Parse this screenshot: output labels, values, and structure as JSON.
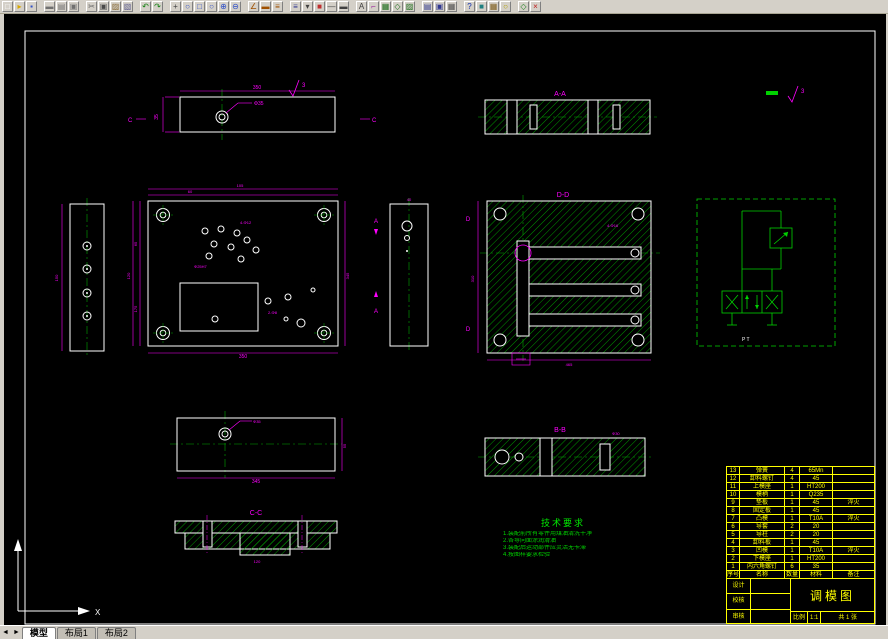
{
  "colors": {
    "chrome": "#d4d0c8",
    "canvas_bg": "#000000",
    "outline": "#ffffff",
    "dimension": "#ff00ff",
    "hatch": "#00a800",
    "annotation_green": "#00d200",
    "table": "#ffff00"
  },
  "toolbar": {
    "icons": [
      {
        "name": "new-icon",
        "glyph": "□",
        "color": "#ffffff"
      },
      {
        "name": "open-icon",
        "glyph": "▸",
        "color": "#d8a800"
      },
      {
        "name": "save-icon",
        "glyph": "▪",
        "color": "#3050c8"
      },
      {
        "name": "plot-icon",
        "glyph": "▬",
        "color": "#707070",
        "sep": true
      },
      {
        "name": "print-preview-icon",
        "glyph": "▤",
        "color": "#707070"
      },
      {
        "name": "publish-icon",
        "glyph": "▣",
        "color": "#707070"
      },
      {
        "name": "cut-icon",
        "glyph": "✂",
        "color": "#606060",
        "sep": true
      },
      {
        "name": "copy-icon",
        "glyph": "▣",
        "color": "#4a4a4a"
      },
      {
        "name": "paste-icon",
        "glyph": "▨",
        "color": "#8a6d3b"
      },
      {
        "name": "match-properties-icon",
        "glyph": "▧",
        "color": "#606090"
      },
      {
        "name": "undo-icon",
        "glyph": "↶",
        "color": "#108010",
        "sep": true
      },
      {
        "name": "redo-icon",
        "glyph": "↷",
        "color": "#108010"
      },
      {
        "name": "pan-icon",
        "glyph": "+",
        "color": "#404040",
        "sep": true
      },
      {
        "name": "zoom-realtime-icon",
        "glyph": "○",
        "color": "#3050c8"
      },
      {
        "name": "zoom-window-icon",
        "glyph": "□",
        "color": "#3050c8"
      },
      {
        "name": "zoom-previous-icon",
        "glyph": "○",
        "color": "#3050c8"
      },
      {
        "name": "zoom-in-icon",
        "glyph": "⊕",
        "color": "#3050c8"
      },
      {
        "name": "zoom-out-icon",
        "glyph": "⊖",
        "color": "#3050c8"
      },
      {
        "name": "distance-icon",
        "glyph": "∠",
        "color": "#a05000",
        "sep": true
      },
      {
        "name": "area-icon",
        "glyph": "▬",
        "color": "#a05000"
      },
      {
        "name": "list-icon",
        "glyph": "≡",
        "color": "#a05000"
      },
      {
        "name": "layers-icon",
        "glyph": "≡",
        "color": "#303890",
        "sep": true
      },
      {
        "name": "layer-control-icon",
        "glyph": "▾",
        "color": "#404040"
      },
      {
        "name": "color-control-icon",
        "glyph": "■",
        "color": "#c03030"
      },
      {
        "name": "linetype-icon",
        "glyph": "—",
        "color": "#404040"
      },
      {
        "name": "lineweight-icon",
        "glyph": "▬",
        "color": "#404040"
      },
      {
        "name": "text-style-icon",
        "glyph": "A",
        "color": "#404040",
        "sep": true
      },
      {
        "name": "dim-style-icon",
        "glyph": "⌐",
        "color": "#a030a0"
      },
      {
        "name": "table-icon",
        "glyph": "▦",
        "color": "#207020"
      },
      {
        "name": "block-icon",
        "glyph": "◇",
        "color": "#207020"
      },
      {
        "name": "hatch-tool-icon",
        "glyph": "▨",
        "color": "#207020"
      },
      {
        "name": "properties-icon",
        "glyph": "▤",
        "color": "#303890",
        "sep": true
      },
      {
        "name": "designcenter-icon",
        "glyph": "▣",
        "color": "#303890"
      },
      {
        "name": "calculator-icon",
        "glyph": "▦",
        "color": "#505050"
      },
      {
        "name": "help-icon",
        "glyph": "?",
        "color": "#1030b0",
        "sep": true
      },
      {
        "name": "render-icon",
        "glyph": "■",
        "color": "#208080"
      },
      {
        "name": "materials-icon",
        "glyph": "▦",
        "color": "#806020"
      },
      {
        "name": "lights-icon",
        "glyph": "○",
        "color": "#b0a000"
      },
      {
        "name": "osnap-icon",
        "glyph": "◇",
        "color": "#208020",
        "sep": true
      },
      {
        "name": "exit-icon",
        "glyph": "×",
        "color": "#c02020"
      }
    ]
  },
  "drawing": {
    "labels": {
      "section_aa": "A-A",
      "section_bb": "B-B",
      "section_cc": "C-C",
      "section_dd": "D-D",
      "ports": "P T",
      "ucs_x": "X",
      "roughness_grade": "3"
    },
    "dims": {
      "plate_width": "350",
      "plate_thick": "35",
      "hole_dia": "Φ35",
      "side_plate_len": "150",
      "v1": "65",
      "v2": "120",
      "v3": "175",
      "plate_height": "345",
      "holes_note": "4-Φ12",
      "bore_note": "Φ25H7",
      "pin_note": "2-Φ8",
      "hatch_height": "310",
      "hatch_width": "465",
      "plate2_w": "40",
      "bottom_thick": "55",
      "cc_dim": "120",
      "bb_dia": "Φ30",
      "t1": "60",
      "t2": "105",
      "holes_note2": "4-Φ16",
      "sec_c": "C",
      "sec_a": "A",
      "sec_d": "D"
    },
    "tech_req": {
      "title": "技术要求",
      "lines": [
        "1.装配前所有零件用煤油清洗干净",
        "2.各导向面涂润滑油",
        "3.装配后运动部件应灵活无卡滞",
        "4.按图样要求检验"
      ]
    }
  },
  "title_block": {
    "parts_header": {
      "no": "序号",
      "name": "名称",
      "qty": "数量",
      "mat": "材料",
      "rem": "备注"
    },
    "parts": [
      {
        "no": "13",
        "name": "弹簧",
        "qty": "4",
        "mat": "65Mn",
        "rem": ""
      },
      {
        "no": "12",
        "name": "卸料螺钉",
        "qty": "4",
        "mat": "45",
        "rem": ""
      },
      {
        "no": "11",
        "name": "上模座",
        "qty": "1",
        "mat": "HT200",
        "rem": ""
      },
      {
        "no": "10",
        "name": "模柄",
        "qty": "1",
        "mat": "Q235",
        "rem": ""
      },
      {
        "no": "9",
        "name": "垫板",
        "qty": "1",
        "mat": "45",
        "rem": "淬火"
      },
      {
        "no": "8",
        "name": "固定板",
        "qty": "1",
        "mat": "45",
        "rem": ""
      },
      {
        "no": "7",
        "name": "凸模",
        "qty": "1",
        "mat": "T10A",
        "rem": "淬火"
      },
      {
        "no": "6",
        "name": "导套",
        "qty": "2",
        "mat": "20",
        "rem": ""
      },
      {
        "no": "5",
        "name": "导柱",
        "qty": "2",
        "mat": "20",
        "rem": ""
      },
      {
        "no": "4",
        "name": "卸料板",
        "qty": "1",
        "mat": "45",
        "rem": ""
      },
      {
        "no": "3",
        "name": "凹模",
        "qty": "1",
        "mat": "T10A",
        "rem": "淬火"
      },
      {
        "no": "2",
        "name": "下模座",
        "qty": "1",
        "mat": "HT200",
        "rem": ""
      },
      {
        "no": "1",
        "name": "内六角螺钉",
        "qty": "6",
        "mat": "35",
        "rem": ""
      }
    ],
    "info": {
      "drawing_name": "调模图",
      "design_label": "设计",
      "check_label": "校核",
      "audit_label": "审核",
      "scale_label": "比例",
      "scale_value": "1:1",
      "sheet_label": "共 1 张"
    }
  },
  "tabs": {
    "nav_prev": "◄",
    "nav_next": "►",
    "items": [
      {
        "name": "tab-model",
        "label": "模型",
        "active": true
      },
      {
        "name": "tab-layout1",
        "label": "布局1"
      },
      {
        "name": "tab-layout2",
        "label": "布局2"
      }
    ]
  }
}
